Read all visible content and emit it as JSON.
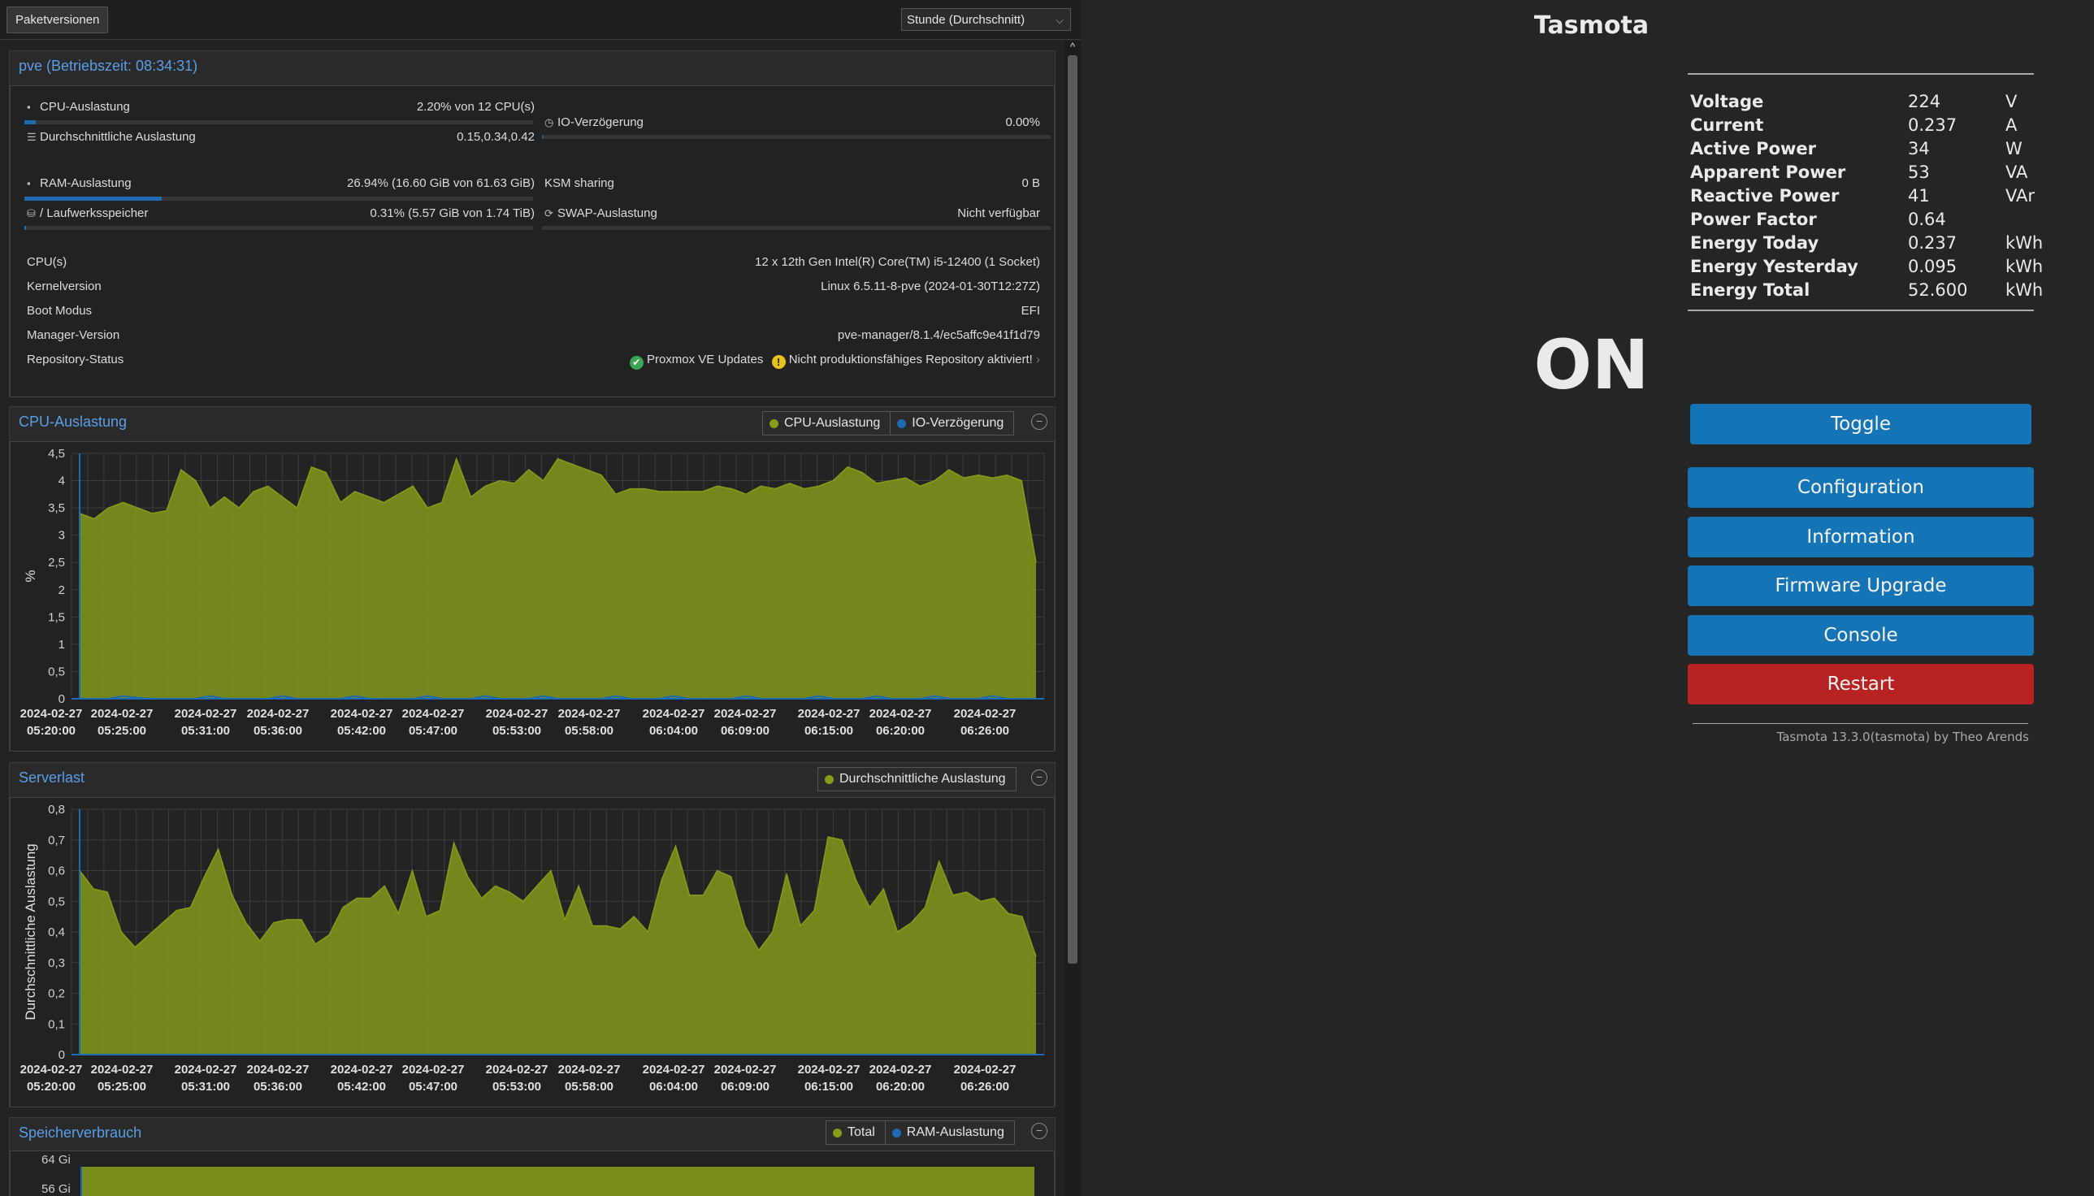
{
  "proxmox": {
    "toolbar": {
      "package_versions": "Paketversionen",
      "timeframe": "Stunde (Durchschnitt)"
    },
    "summary": {
      "title": "pve (Betriebszeit: 08:34:31)",
      "cpu": {
        "label": "CPU-Auslastung",
        "value": "2.20% von 12 CPU(s)",
        "fraction": 0.022
      },
      "load": {
        "label": "Durchschnittliche Auslastung",
        "value": "0.15,0.34,0.42"
      },
      "io": {
        "label": "IO-Verzögerung",
        "value": "0.00%",
        "fraction": 0
      },
      "ram": {
        "label": "RAM-Auslastung",
        "value": "26.94% (16.60 GiB von 61.63 GiB)",
        "fraction": 0.2694
      },
      "ksm": {
        "label": "KSM sharing",
        "value": "0 B"
      },
      "disk": {
        "label": "/ Laufwerksspeicher",
        "value": "0.31% (5.57 GiB von 1.74 TiB)",
        "fraction": 0.0031
      },
      "swap": {
        "label": "SWAP-Auslastung",
        "value": "Nicht verfügbar"
      },
      "info": [
        {
          "label": "CPU(s)",
          "value": "12 x 12th Gen Intel(R) Core(TM) i5-12400 (1 Socket)"
        },
        {
          "label": "Kernelversion",
          "value": "Linux 6.5.11-8-pve (2024-01-30T12:27Z)"
        },
        {
          "label": "Boot Modus",
          "value": "EFI"
        },
        {
          "label": "Manager-Version",
          "value": "pve-manager/8.1.4/ec5affc9e41f1d79"
        }
      ],
      "repo": {
        "label": "Repository-Status",
        "ok": "Proxmox VE Updates",
        "warn": "Nicht produktionsfähiges Repository aktiviert!"
      }
    },
    "cpu_panel": {
      "title": "CPU-Auslastung",
      "legend": [
        "CPU-Auslastung",
        "IO-Verzögerung"
      ]
    },
    "load_panel": {
      "title": "Serverlast",
      "legend": [
        "Durchschnittliche Auslastung"
      ]
    },
    "mem_panel": {
      "title": "Speicherverbrauch",
      "legend": [
        "Total",
        "RAM-Auslastung"
      ],
      "yticks": [
        "64 Gi",
        "56 Gi"
      ]
    }
  },
  "chart_data": [
    {
      "type": "area",
      "title": "CPU-Auslastung",
      "ylabel": "%",
      "ylim": [
        0,
        4.5
      ],
      "yticks": [
        "0",
        "0,5",
        "1",
        "1,5",
        "2",
        "2,5",
        "3",
        "3,5",
        "4",
        "4,5"
      ],
      "xticks": [
        "2024-02-27 05:20:00",
        "2024-02-27 05:25:00",
        "2024-02-27 05:31:00",
        "2024-02-27 05:36:00",
        "2024-02-27 05:42:00",
        "2024-02-27 05:47:00",
        "2024-02-27 05:53:00",
        "2024-02-27 05:58:00",
        "2024-02-27 06:04:00",
        "2024-02-27 06:09:00",
        "2024-02-27 06:15:00",
        "2024-02-27 06:20:00",
        "2024-02-27 06:26:00"
      ],
      "series": [
        {
          "name": "CPU-Auslastung",
          "color": "#8a9a1a",
          "values": [
            3.4,
            3.3,
            3.5,
            3.6,
            3.5,
            3.4,
            3.45,
            4.2,
            4.0,
            3.5,
            3.7,
            3.5,
            3.8,
            3.9,
            3.7,
            3.5,
            4.25,
            4.15,
            3.6,
            3.8,
            3.7,
            3.6,
            3.75,
            3.9,
            3.5,
            3.6,
            4.4,
            3.7,
            3.9,
            4.0,
            3.95,
            4.2,
            4.0,
            4.4,
            4.3,
            4.2,
            4.1,
            3.75,
            3.85,
            3.85,
            3.8,
            3.8,
            3.8,
            3.8,
            3.9,
            3.85,
            3.75,
            3.9,
            3.85,
            3.95,
            3.85,
            3.9,
            4.0,
            4.25,
            4.15,
            3.95,
            4.0,
            4.05,
            3.9,
            4.0,
            4.2,
            4.05,
            4.1,
            4.05,
            4.1,
            4.0,
            2.5
          ]
        },
        {
          "name": "IO-Verzögerung",
          "color": "#1d6bb3",
          "values": [
            0,
            0,
            0,
            0.05,
            0.02,
            0,
            0,
            0,
            0,
            0.05,
            0,
            0,
            0,
            0,
            0.05,
            0,
            0,
            0,
            0,
            0.05,
            0,
            0,
            0,
            0,
            0.05,
            0,
            0,
            0,
            0.05,
            0,
            0,
            0,
            0.05,
            0,
            0,
            0,
            0,
            0.05,
            0,
            0,
            0,
            0.05,
            0,
            0,
            0,
            0,
            0.05,
            0,
            0,
            0,
            0,
            0.05,
            0,
            0,
            0,
            0.05,
            0,
            0,
            0,
            0.05,
            0,
            0,
            0,
            0.05,
            0,
            0,
            0
          ]
        }
      ]
    },
    {
      "type": "area",
      "title": "Serverlast",
      "ylabel": "Durchschnittliche Auslastung",
      "ylim": [
        0,
        0.8
      ],
      "yticks": [
        "0",
        "0,1",
        "0,2",
        "0,3",
        "0,4",
        "0,5",
        "0,6",
        "0,7",
        "0,8"
      ],
      "xticks": [
        "2024-02-27 05:20:00",
        "2024-02-27 05:25:00",
        "2024-02-27 05:31:00",
        "2024-02-27 05:36:00",
        "2024-02-27 05:42:00",
        "2024-02-27 05:47:00",
        "2024-02-27 05:53:00",
        "2024-02-27 05:58:00",
        "2024-02-27 06:04:00",
        "2024-02-27 06:09:00",
        "2024-02-27 06:15:00",
        "2024-02-27 06:20:00",
        "2024-02-27 06:26:00"
      ],
      "series": [
        {
          "name": "Durchschnittliche Auslastung",
          "color": "#8a9a1a",
          "values": [
            0.6,
            0.54,
            0.53,
            0.4,
            0.35,
            0.39,
            0.43,
            0.47,
            0.48,
            0.58,
            0.67,
            0.52,
            0.43,
            0.37,
            0.43,
            0.44,
            0.44,
            0.36,
            0.39,
            0.48,
            0.51,
            0.51,
            0.55,
            0.46,
            0.6,
            0.45,
            0.47,
            0.69,
            0.58,
            0.51,
            0.55,
            0.53,
            0.5,
            0.55,
            0.6,
            0.44,
            0.55,
            0.42,
            0.42,
            0.41,
            0.45,
            0.4,
            0.57,
            0.68,
            0.52,
            0.52,
            0.6,
            0.58,
            0.42,
            0.34,
            0.4,
            0.59,
            0.42,
            0.47,
            0.71,
            0.7,
            0.57,
            0.48,
            0.54,
            0.4,
            0.43,
            0.48,
            0.63,
            0.52,
            0.53,
            0.5,
            0.51,
            0.46,
            0.45,
            0.32
          ]
        }
      ]
    }
  ],
  "tasmota": {
    "title": "Tasmota",
    "sensors": [
      {
        "label": "Voltage",
        "value": "224",
        "unit": "V"
      },
      {
        "label": "Current",
        "value": "0.237",
        "unit": "A"
      },
      {
        "label": "Active Power",
        "value": "34",
        "unit": "W"
      },
      {
        "label": "Apparent Power",
        "value": "53",
        "unit": "VA"
      },
      {
        "label": "Reactive Power",
        "value": "41",
        "unit": "VAr"
      },
      {
        "label": "Power Factor",
        "value": "0.64",
        "unit": ""
      },
      {
        "label": "Energy Today",
        "value": "0.237",
        "unit": "kWh"
      },
      {
        "label": "Energy Yesterday",
        "value": "0.095",
        "unit": "kWh"
      },
      {
        "label": "Energy Total",
        "value": "52.600",
        "unit": "kWh"
      }
    ],
    "state": "ON",
    "buttons": {
      "toggle": "Toggle",
      "configuration": "Configuration",
      "information": "Information",
      "firmware": "Firmware Upgrade",
      "console": "Console",
      "restart": "Restart"
    },
    "footer": "Tasmota 13.3.0(tasmota) by Theo Arends",
    "colors": {
      "button": "#1474b5",
      "restart": "#b82222",
      "background": "#252525"
    }
  }
}
